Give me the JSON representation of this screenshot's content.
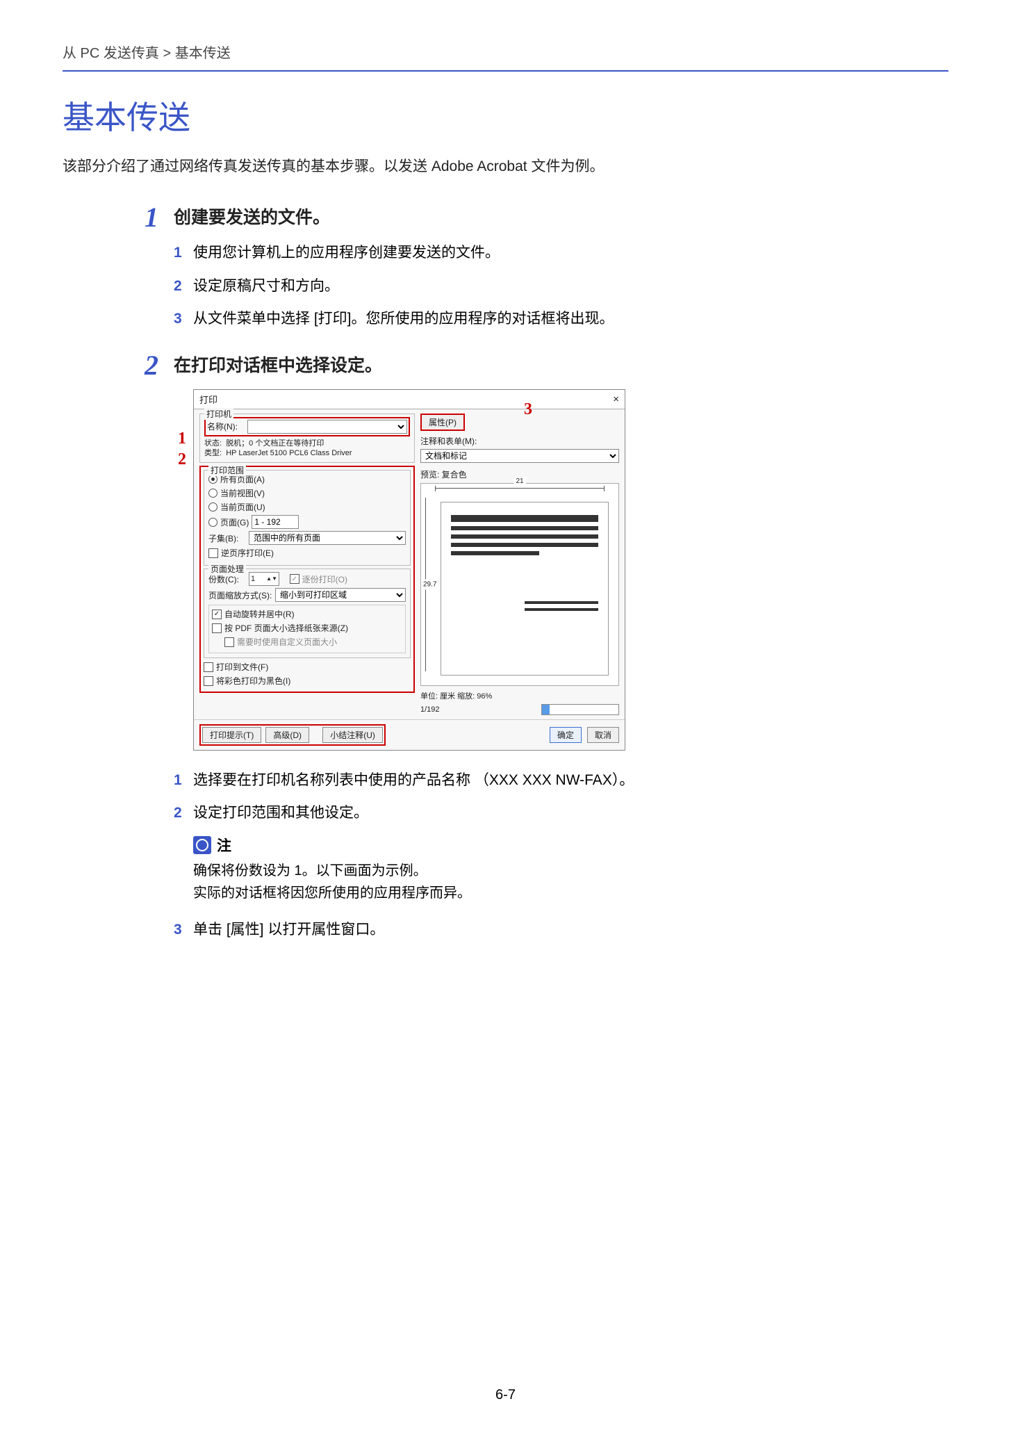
{
  "breadcrumb": "从 PC 发送传真 > 基本传送",
  "title": "基本传送",
  "intro": "该部分介绍了通过网络传真发送传真的基本步骤。以发送 Adobe Acrobat 文件为例。",
  "steps": [
    {
      "num": "1",
      "heading": "创建要发送的文件。",
      "subs": [
        {
          "n": "1",
          "t": "使用您计算机上的应用程序创建要发送的文件。"
        },
        {
          "n": "2",
          "t": "设定原稿尺寸和方向。"
        },
        {
          "n": "3",
          "t": "从文件菜单中选择 [打印]。您所使用的应用程序的对话框将出现。"
        }
      ]
    },
    {
      "num": "2",
      "heading": "在打印对话框中选择设定。",
      "callouts": {
        "c1": "1",
        "c2": "2",
        "c3": "3"
      },
      "dialog": {
        "title": "打印",
        "close": "×",
        "printer": {
          "group": "打印机",
          "name_lbl": "名称(N):",
          "name_val": "",
          "properties_btn": "属性(P)",
          "status_lbl": "状态:",
          "status_val": "脱机；0 个文档正在等待打印",
          "type_lbl": "类型:",
          "type_val": "HP LaserJet 5100 PCL6 Class Driver",
          "comments_lbl": "注释和表单(M):",
          "comments_val": "文档和标记"
        },
        "range": {
          "group": "打印范围",
          "all": "所有页面(A)",
          "current_view": "当前视图(V)",
          "current_page": "当前页面(U)",
          "pages_lbl": "页面(G)",
          "pages_val": "1 - 192",
          "subset_lbl": "子集(B):",
          "subset_val": "范围中的所有页面",
          "reverse": "逆页序打印(E)"
        },
        "handling": {
          "group": "页面处理",
          "copies_lbl": "份数(C):",
          "copies_val": "1",
          "collate": "逐份打印(O)",
          "scale_lbl": "页面缩放方式(S):",
          "scale_val": "缩小到可打印区域",
          "autorotate": "自动旋转并居中(R)",
          "pdf_size": "按 PDF 页面大小选择纸张来源(Z)",
          "custom_size": "需要时使用自定义页面大小"
        },
        "misc": {
          "tofile": "打印到文件(F)",
          "toblack": "将彩色打印为黑色(I)"
        },
        "preview": {
          "label": "预览: 复合色",
          "width": "21",
          "height": "29.7",
          "units_line": "单位: 厘米 缩放:  96%",
          "pager": "1/192"
        },
        "footer": {
          "tips": "打印提示(T)",
          "advanced": "高级(D)",
          "summary": "小结注释(U)",
          "ok": "确定",
          "cancel": "取消"
        }
      },
      "after": [
        {
          "n": "1",
          "t": "选择要在打印机名称列表中使用的产品名称 （XXX XXX NW-FAX）。"
        },
        {
          "n": "2",
          "t": "设定打印范围和其他设定。"
        }
      ],
      "note": {
        "head": "注",
        "line1": "确保将份数设为 1。以下画面为示例。",
        "line2": "实际的对话框将因您所使用的应用程序而异。"
      },
      "after2": [
        {
          "n": "3",
          "t": "单击 [属性] 以打开属性窗口。"
        }
      ]
    }
  ],
  "page_num": "6-7"
}
